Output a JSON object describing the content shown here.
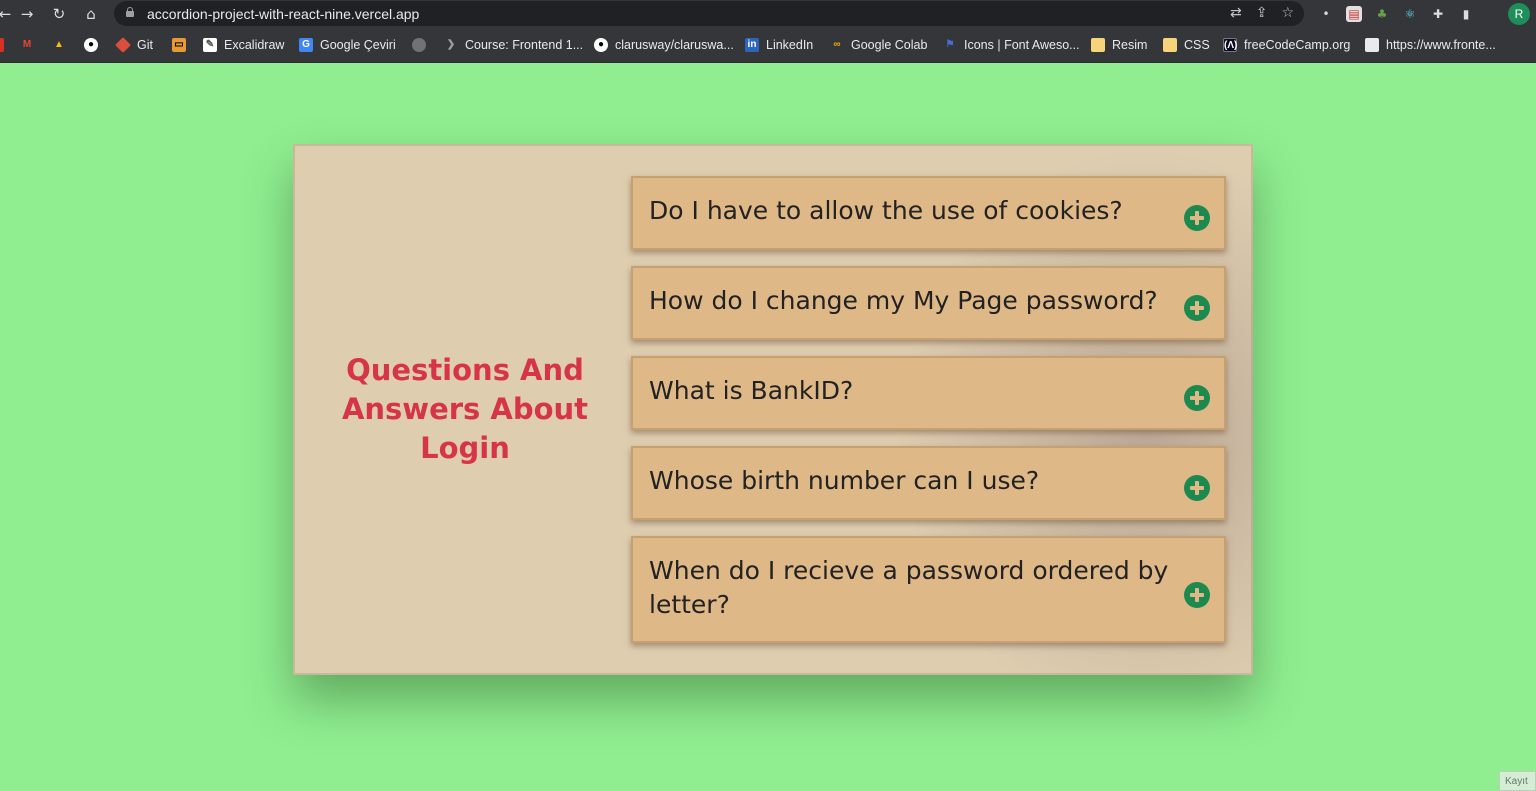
{
  "browser": {
    "url": "accordion-project-with-react-nine.vercel.app",
    "profile_initial": "R",
    "bookmarks": [
      {
        "label": "Git",
        "icon": "git-icon",
        "color": "#d94f3d"
      },
      {
        "label": "",
        "icon": "bookmark-icon",
        "color": "#e89a36"
      },
      {
        "label": "Excalidraw",
        "icon": "excalidraw-icon",
        "color": "#ffffff"
      },
      {
        "label": "Google Çeviri",
        "icon": "translate-icon",
        "color": "#4285f4"
      },
      {
        "label": "",
        "icon": "globe-icon",
        "color": "#9aa0a6"
      },
      {
        "label": "Course: Frontend 1...",
        "icon": "course-icon",
        "color": "#9aa0a6"
      },
      {
        "label": "clarusway/claruswa...",
        "icon": "github-icon",
        "color": "#ffffff"
      },
      {
        "label": "LinkedIn",
        "icon": "linkedin-icon",
        "color": "#2d64bc"
      },
      {
        "label": "Google Colab",
        "icon": "colab-icon",
        "color": "#f9ab00"
      },
      {
        "label": "Icons | Font Aweso...",
        "icon": "flag-icon",
        "color": "#4a6cd4"
      },
      {
        "label": "Resim",
        "icon": "folder-icon",
        "color": "#f5d47a"
      },
      {
        "label": "CSS",
        "icon": "folder-icon",
        "color": "#f5d47a"
      },
      {
        "label": "freeCodeCamp.org",
        "icon": "freecodecamp-icon",
        "color": "#0a0a23"
      },
      {
        "label": "https://www.fronte...",
        "icon": "page-icon",
        "color": "#e8eaed"
      }
    ]
  },
  "page": {
    "title": "Questions And Answers About Login",
    "questions": [
      "Do I have to allow the use of cookies?",
      "How do I change my My Page password?",
      "What is BankID?",
      "Whose birth number can I use?",
      "When do I recieve a password ordered by letter?"
    ],
    "accent_color": "#d63447",
    "item_background": "#dfb888",
    "icon_color": "#1c8a4e"
  },
  "corner_label": "Kayıt"
}
